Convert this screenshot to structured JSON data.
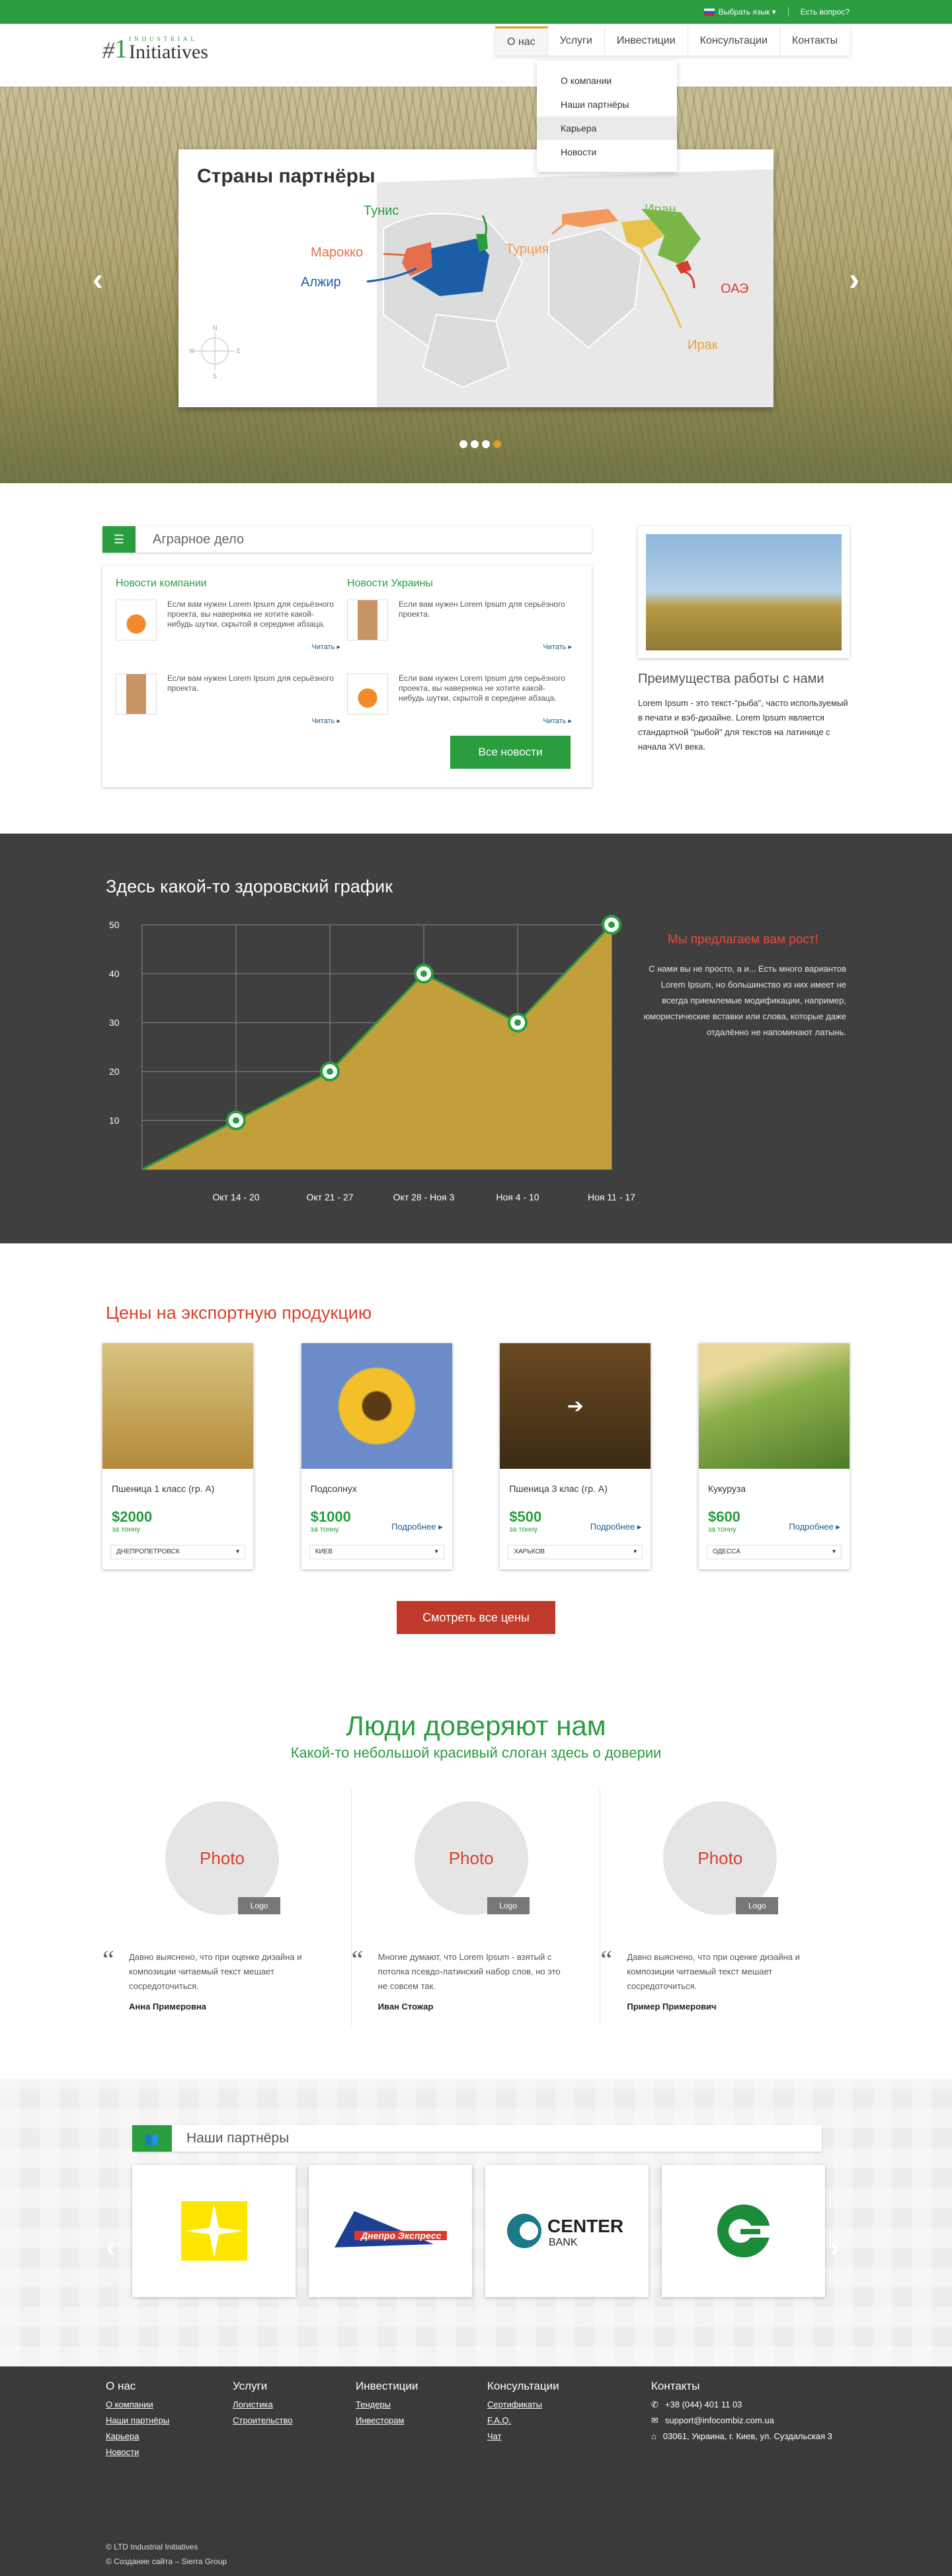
{
  "topbar": {
    "language": "Выбрать язык ▾",
    "question": "Есть вопрос?"
  },
  "logo": {
    "hash": "#",
    "one": "1",
    "small": "INDUSTRIAL",
    "big": "Initiatives"
  },
  "nav": {
    "items": [
      "О нас",
      "Услуги",
      "Инвестиции",
      "Консультации",
      "Контакты"
    ],
    "dropdown": [
      "О компании",
      "Наши партнёры",
      "Карьера",
      "Новости"
    ]
  },
  "hero": {
    "title": "Страны партнёры",
    "countries": [
      "Тунис",
      "Марокко",
      "Алжир",
      "Турция",
      "Иран",
      "ОАЭ",
      "Ирак"
    ],
    "compass": [
      "N",
      "S",
      "W",
      "E"
    ],
    "slides": 4,
    "active_slide": 4
  },
  "agri": {
    "title": "Аграрное дело",
    "company_news_title": "Новости компании",
    "ukraine_news_title": "Новости Украины",
    "news": [
      {
        "text": "Если вам нужен Lorem Ipsum для серьёзного проекта, вы наверняка не хотите какой-нибудь шутки, скрытой в середине абзаца.",
        "read": "Читать ▸"
      },
      {
        "text": "Если вам нужен Lorem Ipsum для серьёзного проекта.",
        "read": "Читать ▸"
      },
      {
        "text": "Если вам нужен Lorem Ipsum для серьёзного проекта.",
        "read": "Читать ▸"
      },
      {
        "text": "Если вам нужен Lorem Ipsum для серьёзного проекта, вы наверняка не хотите какой-нибудь шутки, скрытой в середине абзаца.",
        "read": "Читать ▸"
      }
    ],
    "all_news": "Все новости",
    "side_title": "Преимущества работы с нами",
    "side_text": "Lorem Ipsum - это текст-\"рыба\", часто используемый в печати и вэб-дизайне. Lorem Ipsum является стандартной \"рыбой\" для текстов на латинице с начала XVI века."
  },
  "chart": {
    "heading": "Здесь какой-то здоровский график",
    "grow_title": "Мы предлагаем вам рост!",
    "grow_text": "С нами вы не просто, а и... Есть много вариантов Lorem Ipsum, но большинство из них имеет не всегда приемлемые модификации, например, юмористические вставки или слова, которые даже отдалённо не напоминают латынь."
  },
  "chart_data": {
    "type": "area",
    "categories": [
      "",
      "Окт 14 - 20",
      "Окт 21 - 27",
      "Окт 28 - Ноя 3",
      "Ноя 4 - 10",
      "Ноя 11 - 17"
    ],
    "values": [
      0,
      10,
      20,
      40,
      30,
      50
    ],
    "yticks": [
      10,
      20,
      30,
      40,
      50
    ],
    "ylim": [
      0,
      50
    ],
    "grid": true,
    "fill_color": "#c9a43a",
    "line_color": "#2a9d3f"
  },
  "prices": {
    "title": "Цены на экспортную продукцию",
    "items": [
      {
        "name": "Пшеница 1 класс (гр. А)",
        "price": "$2000",
        "per": "за тонну",
        "more": "",
        "city": "ДНЕПРОПЕТРОВСК"
      },
      {
        "name": "Подсолнух",
        "price": "$1000",
        "per": "за тонну",
        "more": "Подробнее ▸",
        "city": "КИЕВ"
      },
      {
        "name": "Пшеница 3 клас (гр. А)",
        "price": "$500",
        "per": "за тонну",
        "more": "Подробнее ▸",
        "city": "ХАРЬКОВ"
      },
      {
        "name": "Кукуруза",
        "price": "$600",
        "per": "за тонну",
        "more": "Подробнее ▸",
        "city": "ОДЕССА"
      }
    ],
    "button": "Смотреть все цены"
  },
  "trust": {
    "title": "Люди доверяют нам",
    "slogan": "Какой-то небольшой красивый слоган здесь о доверии",
    "photo": "Photo",
    "logo": "Logo",
    "people": [
      {
        "quote": "Давно выяснено, что при оценке дизайна и композиции читаемый текст мешает сосредоточиться.",
        "name": "Анна Примеровна"
      },
      {
        "quote": "Многие думают, что Lorem Ipsum - взятый с потолка псевдо-латинский набор слов, но это не совсем так.",
        "name": "Иван Стожар"
      },
      {
        "quote": "Давно выяснено, что при оценке дизайна и композиции читаемый текст мешает сосредоточиться.",
        "name": "Пример Примерович"
      }
    ]
  },
  "partners": {
    "title": "Наши партнёры",
    "center_bank": "CENTER",
    "center_bank_sub": "BANK",
    "dnepro": "Днепро Экспресс"
  },
  "footer": {
    "about": {
      "title": "О нас",
      "links": [
        "О компании",
        "Наши партнёры",
        "Карьера",
        "Новости"
      ]
    },
    "services": {
      "title": "Услуги",
      "links": [
        "Логистика",
        "Строительство"
      ]
    },
    "invest": {
      "title": "Инвестиции",
      "links": [
        "Тендеры",
        "Инвесторам"
      ]
    },
    "consult": {
      "title": "Консультации",
      "links": [
        "Сертификаты",
        "F.A.Q.",
        "Чат"
      ]
    },
    "contacts": {
      "title": "Контакты",
      "phone": "+38 (044) 401 11 03",
      "email": "support@infocombiz.com.ua",
      "address": "03061, Украина, г. Киев, ул. Суздальская 3"
    },
    "copyright": "© LTD Industrial Initiatives",
    "creator": "© Создание сайта – Sierra Group"
  }
}
